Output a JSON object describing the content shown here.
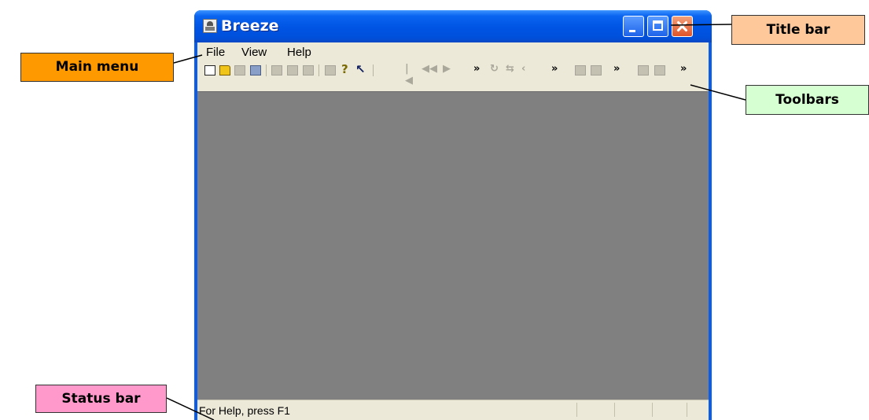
{
  "window": {
    "title": "Breeze",
    "controls": [
      "minimize",
      "maximize",
      "close"
    ]
  },
  "menu": {
    "items": [
      "File",
      "View",
      "Help"
    ]
  },
  "toolbar": {
    "chevron": "»",
    "icons": [
      "new-icon",
      "open-icon",
      "open-disabled-icon",
      "save-icon",
      "cut-icon",
      "copy-icon",
      "paste-icon",
      "print-icon",
      "help-icon",
      "context-help-icon",
      "first-icon",
      "rewind-icon",
      "play-icon",
      "rotate-icon",
      "zoom-icon",
      "left-icon",
      "frame-icon",
      "frame2-icon",
      "page-icon",
      "page2-icon"
    ]
  },
  "status": {
    "text": "For Help, press F1"
  },
  "callouts": {
    "title_bar": "Title bar",
    "main_menu": "Main menu",
    "toolbars": "Toolbars",
    "status_bar": "Status bar"
  },
  "colors": {
    "titlebar": "#0054e3",
    "callout_title": "#ffc89b",
    "callout_menu": "#ff9900",
    "callout_toolbars": "#d6ffd2",
    "callout_status": "#ff99cc",
    "workspace": "#808080"
  }
}
